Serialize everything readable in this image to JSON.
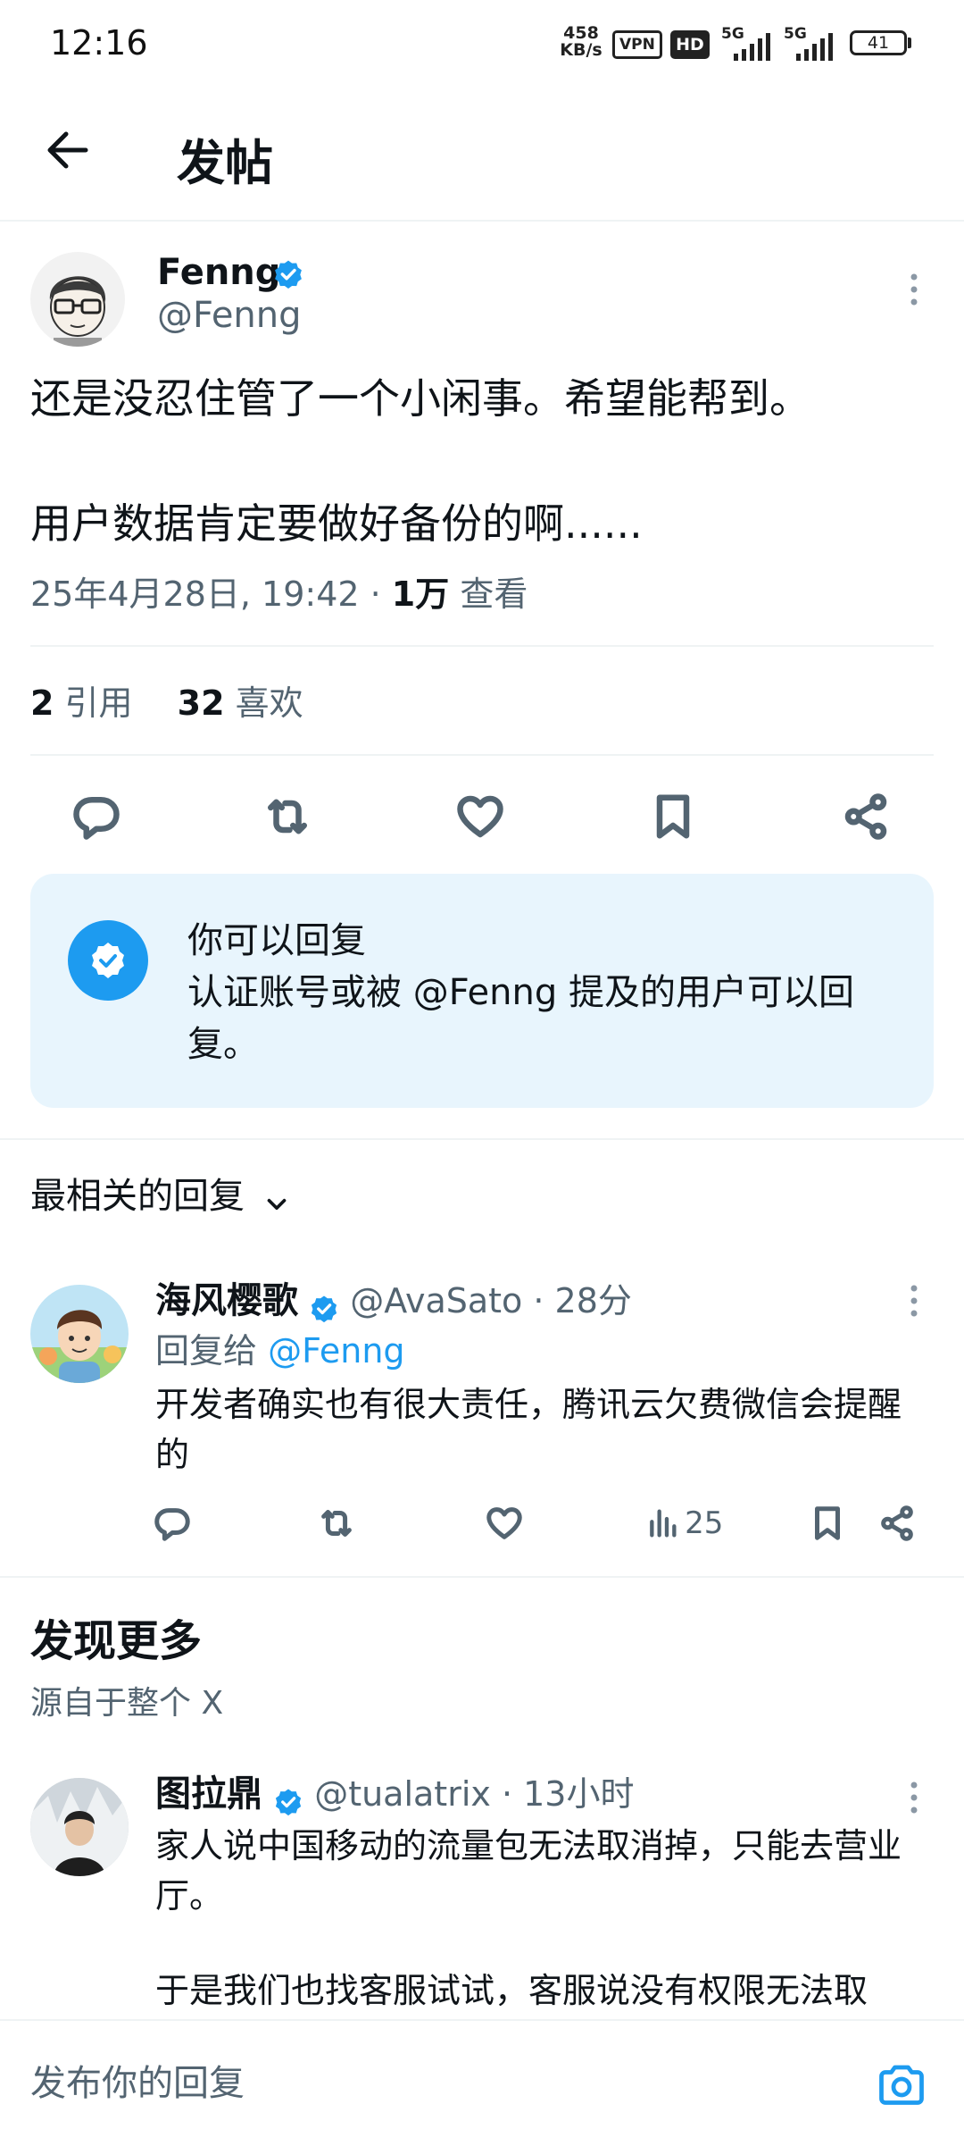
{
  "status_bar": {
    "time": "12:16",
    "net_speed_value": "458",
    "net_speed_unit": "KB/s",
    "vpn": "VPN",
    "hd": "HD",
    "net1": "5G",
    "net2": "5G",
    "battery": "41"
  },
  "header": {
    "title": "发帖"
  },
  "post": {
    "author_name": "Fenng",
    "author_handle": "@Fenng",
    "line1": "还是没忍住管了一个小闲事。希望能帮到。",
    "line2": "用户数据肯定要做好备份的啊......",
    "timestamp": "25年4月28日, 19:42 · ",
    "views_count": "1万",
    "views_label": " 查看",
    "quotes_count": "2",
    "quotes_label": "引用",
    "likes_count": "32",
    "likes_label": "喜欢"
  },
  "reply_notice": {
    "title": "你可以回复",
    "text": "认证账号或被 @Fenng 提及的用户可以回复。"
  },
  "sort": {
    "label": "最相关的回复"
  },
  "reply": {
    "name": "海风樱歌",
    "handle_time": "@AvaSato · 28分",
    "replying_prefix": "回复给 ",
    "replying_to": "@Fenng",
    "text": "开发者确实也有很大责任，腾讯云欠费微信会提醒的",
    "views": "25"
  },
  "discover": {
    "title": "发现更多",
    "subtitle": "源自于整个 X"
  },
  "more_post": {
    "name": "图拉鼎",
    "handle_time": "@tualatrix · 13小时",
    "text1": "家人说中国移动的流量包无法取消掉，只能去营业厅。",
    "text2": "于是我们也找客服试试，客服说没有权限无法取"
  },
  "compose": {
    "placeholder": "发布你的回复"
  },
  "colors": {
    "accent": "#1d9bf0",
    "secondary_text": "#536471",
    "notice_bg": "#e8f5fd"
  }
}
